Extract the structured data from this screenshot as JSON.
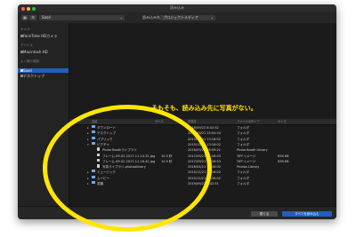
{
  "window": {
    "title": "読み込み"
  },
  "toolbar": {
    "location": "Saori",
    "import_label": "読み込み先:",
    "import_select": "プロジェクトメディア"
  },
  "sidebar": {
    "sections": [
      {
        "title": "カメラ",
        "items": [
          "FaceTime HDカメラ"
        ]
      },
      {
        "title": "デバイス",
        "items": [
          "Macintosh HD"
        ]
      },
      {
        "title": "よく使う項目",
        "items": [
          "Saori",
          "デスクトップ"
        ]
      }
    ]
  },
  "table": {
    "headers": [
      "名前",
      "サイズ",
      "作成日",
      "ファイルのタイプ",
      "サイズ"
    ],
    "rows": [
      {
        "indent": 0,
        "kind": "folder",
        "name": "ダウンロード",
        "date": "2018/09/22 8:42:52",
        "type": "フォルダ",
        "size": ""
      },
      {
        "indent": 0,
        "kind": "folder",
        "name": "デスクトップ",
        "date": "2017/09/21 15:04:34",
        "type": "フォルダ",
        "size": ""
      },
      {
        "indent": 0,
        "kind": "folder",
        "name": "パブリック",
        "date": "2015/12/21 13:16:02",
        "type": "フォルダ",
        "size": ""
      },
      {
        "indent": 0,
        "kind": "folder",
        "name": "ピクチャ",
        "date": "2015/12/21 13:16:02",
        "type": "フォルダ",
        "size": ""
      },
      {
        "indent": 1,
        "kind": "file",
        "name": "Photo Boothライブラリ",
        "dur": "",
        "date": "2016/03/28 16:59:21",
        "type": "Photo Booth Library",
        "size": ""
      },
      {
        "indent": 1,
        "kind": "file",
        "name": "フレーム-09-02-2017-11-14-31.jpg",
        "dur": "10.5 秒",
        "date": "2017/09/21 11:16:03",
        "type": "TIFFイメージ",
        "size": "636 KB"
      },
      {
        "indent": 1,
        "kind": "file",
        "name": "フレーム-09-02-2017-11-16-42.jpg",
        "dur": "10.5 秒",
        "date": "2017/09/21 11:16:53",
        "type": "TIFFイメージ",
        "size": "636 KB"
      },
      {
        "indent": 1,
        "kind": "file",
        "name": "写真ライブラリ.photoslibrary",
        "dur": "",
        "date": "2016/04/11 13:16:02",
        "type": "Photos Library",
        "size": ""
      },
      {
        "indent": 0,
        "kind": "folder",
        "name": "ミュージック",
        "date": "2015/12/21 13:16:02",
        "type": "フォルダ",
        "size": ""
      },
      {
        "indent": 0,
        "kind": "folder",
        "name": "ムービー",
        "date": "2015/12/21 13:16:02",
        "type": "フォルダ",
        "size": ""
      },
      {
        "indent": 0,
        "kind": "folder",
        "name": "書類",
        "date": "2019/09/22 8:42:51",
        "type": "フォルダ",
        "size": ""
      }
    ]
  },
  "annotation": "そもそも、読み込み先に写真がない。",
  "footer": {
    "close": "閉じる",
    "import_all": "すべてを読み込む"
  },
  "colors": {
    "highlight": "#1f5fbf",
    "annotation": "#ffe100"
  }
}
